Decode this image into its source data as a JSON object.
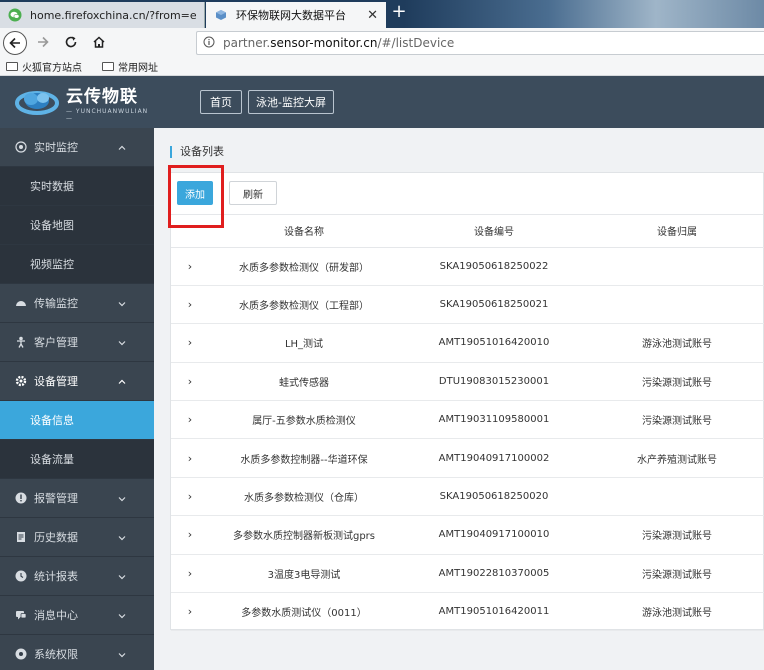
{
  "browser": {
    "tabs": [
      {
        "title": "home.firefoxchina.cn/?from=extra_start",
        "active": false
      },
      {
        "title": "环保物联网大数据平台",
        "active": true
      }
    ],
    "url_prefix": "partner.",
    "url_host": "sensor-monitor.cn",
    "url_path": "/#/listDevice",
    "bookmarks": [
      "火狐官方站点",
      "常用网址"
    ]
  },
  "header": {
    "logo_cn": "云传物联",
    "logo_en": "— YUNCHUANWULIAN —",
    "buttons": [
      "首页",
      "泳池-监控大屏"
    ]
  },
  "sidebar": {
    "items": [
      {
        "label": "实时监控",
        "type": "group",
        "icon": "target-icon",
        "expanded": true
      },
      {
        "label": "实时数据",
        "type": "sub"
      },
      {
        "label": "设备地图",
        "type": "sub"
      },
      {
        "label": "视频监控",
        "type": "sub"
      },
      {
        "label": "传输监控",
        "type": "group",
        "icon": "gauge-icon",
        "expanded": false
      },
      {
        "label": "客户管理",
        "type": "group",
        "icon": "person-icon",
        "expanded": false
      },
      {
        "label": "设备管理",
        "type": "group",
        "icon": "gear-icon",
        "expanded": true
      },
      {
        "label": "设备信息",
        "type": "sub",
        "active": true
      },
      {
        "label": "设备流量",
        "type": "sub"
      },
      {
        "label": "报警管理",
        "type": "group",
        "icon": "alert-icon",
        "expanded": false
      },
      {
        "label": "历史数据",
        "type": "group",
        "icon": "document-icon",
        "expanded": false
      },
      {
        "label": "统计报表",
        "type": "group",
        "icon": "clock-icon",
        "expanded": false
      },
      {
        "label": "消息中心",
        "type": "group",
        "icon": "chat-icon",
        "expanded": false
      },
      {
        "label": "系统权限",
        "type": "group",
        "icon": "settings-icon",
        "expanded": false
      }
    ]
  },
  "main": {
    "page_title": "设备列表",
    "add_label": "添加",
    "refresh_label": "刷新",
    "columns": [
      "",
      "设备名称",
      "设备编号",
      "设备归属"
    ],
    "rows": [
      [
        "水质多参数检测仪（研发部）",
        "SKA19050618250022",
        ""
      ],
      [
        "水质多参数检测仪（工程部）",
        "SKA19050618250021",
        ""
      ],
      [
        "LH_测试",
        "AMT19051016420010",
        "游泳池测试账号"
      ],
      [
        "蛙式传感器",
        "DTU19083015230001",
        "污染源测试账号"
      ],
      [
        "属厅-五参数水质检测仪",
        "AMT19031109580001",
        "污染源测试账号"
      ],
      [
        "水质多参数控制器--华道环保",
        "AMT19040917100002",
        "水产养殖测试账号"
      ],
      [
        "水质多参数检测仪（仓库）",
        "SKA19050618250020",
        ""
      ],
      [
        "多参数水质控制器新板测试gprs",
        "AMT19040917100010",
        "污染源测试账号"
      ],
      [
        "3温度3电导测试",
        "AMT19022810370005",
        "污染源测试账号"
      ],
      [
        "多参数水质测试仪（0011）",
        "AMT19051016420011",
        "游泳池测试账号"
      ]
    ]
  },
  "colors": {
    "accent": "#3ba7dc",
    "sidebar_bg": "#343e49",
    "header_bg": "#3c4c5c",
    "highlight": "#e01e1e"
  }
}
